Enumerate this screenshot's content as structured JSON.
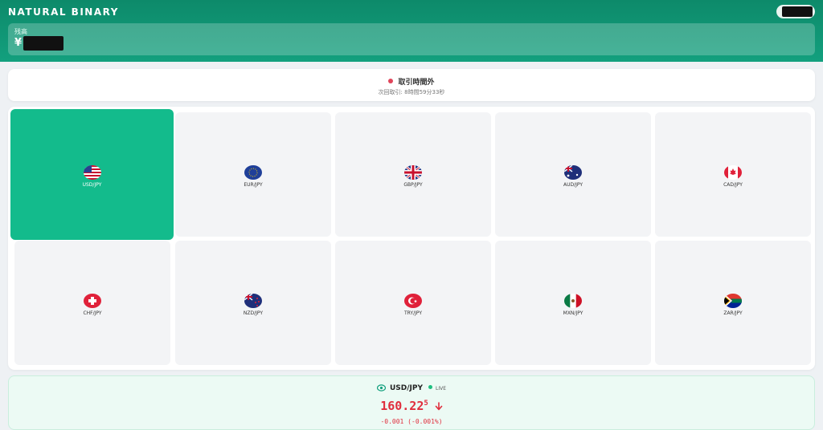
{
  "header": {
    "brand": "NATURAL BINARY",
    "balance_label": "残高",
    "balance_currency": "¥"
  },
  "market_status": {
    "title": "取引時間外",
    "next_trade": "次回取引: 8時間59分33秒"
  },
  "pairs": [
    {
      "label": "USD/JPY",
      "flag": "us-flag-icon",
      "selected": true
    },
    {
      "label": "EUR/JPY",
      "flag": "eu-flag-icon",
      "selected": false
    },
    {
      "label": "GBP/JPY",
      "flag": "uk-flag-icon",
      "selected": false
    },
    {
      "label": "AUD/JPY",
      "flag": "au-flag-icon",
      "selected": false
    },
    {
      "label": "CAD/JPY",
      "flag": "ca-flag-icon",
      "selected": false
    },
    {
      "label": "CHF/JPY",
      "flag": "ch-flag-icon",
      "selected": false
    },
    {
      "label": "NZD/JPY",
      "flag": "nz-flag-icon",
      "selected": false
    },
    {
      "label": "TRY/JPY",
      "flag": "tr-flag-icon",
      "selected": false
    },
    {
      "label": "MXN/JPY",
      "flag": "mx-flag-icon",
      "selected": false
    },
    {
      "label": "ZAR/JPY",
      "flag": "za-flag-icon",
      "selected": false
    }
  ],
  "price": {
    "pair": "USD/JPY",
    "live_label": "LIVE",
    "price_main": "160.22",
    "price_pip": "5",
    "change": "-0.001 (-0.001%)"
  },
  "colors": {
    "brand": "#0d8a6a",
    "selected": "#13bb8c",
    "down": "#e02e3d",
    "live": "#1fbf7f"
  }
}
